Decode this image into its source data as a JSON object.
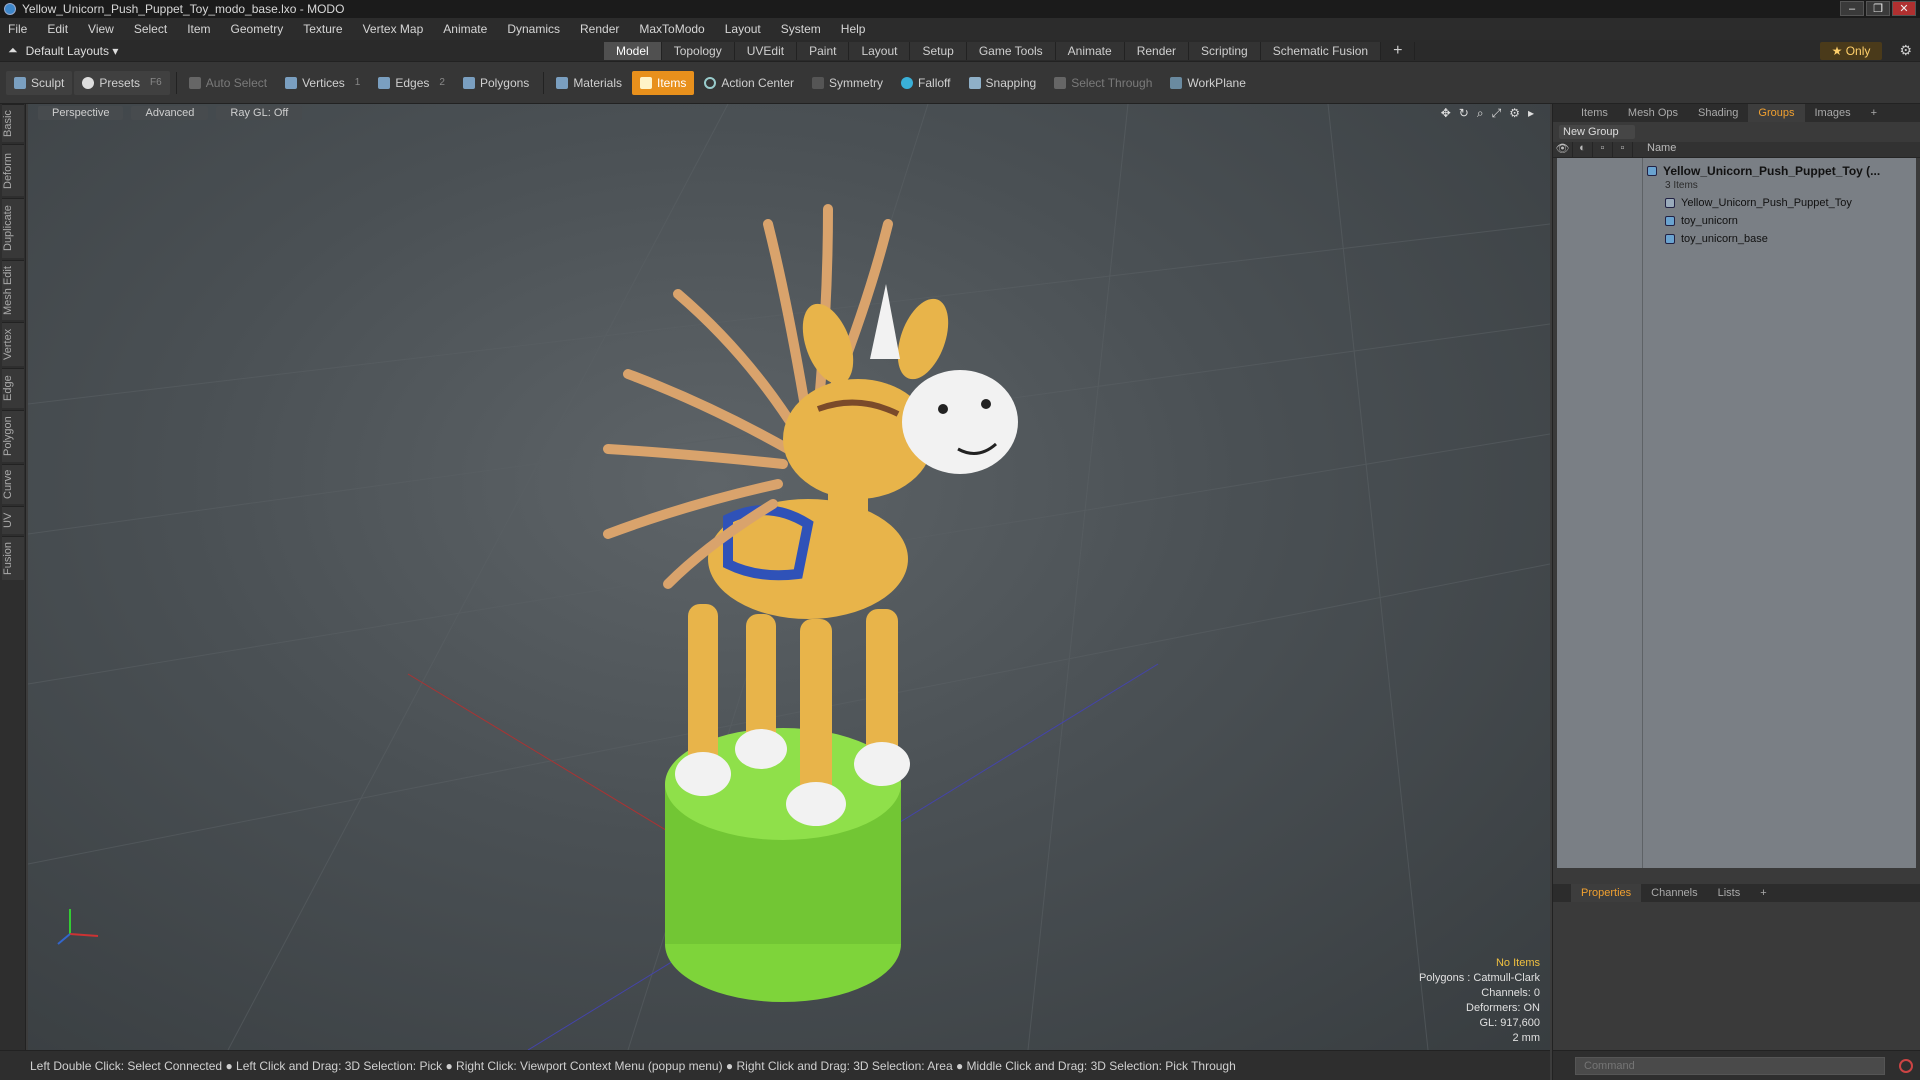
{
  "window": {
    "title": "Yellow_Unicorn_Push_Puppet_Toy_modo_base.lxo - MODO",
    "controls": [
      "–",
      "❐",
      "✕"
    ]
  },
  "menu": [
    "File",
    "Edit",
    "View",
    "Select",
    "Item",
    "Geometry",
    "Texture",
    "Vertex Map",
    "Animate",
    "Dynamics",
    "Render",
    "MaxToModo",
    "Layout",
    "System",
    "Help"
  ],
  "layout": {
    "dropdown": "Default Layouts ▾",
    "tabs": [
      "Model",
      "Topology",
      "UVEdit",
      "Paint",
      "Layout",
      "Setup",
      "Game Tools",
      "Animate",
      "Render",
      "Scripting",
      "Schematic Fusion",
      "+"
    ],
    "active_tab": "Model",
    "only_label": "★  Only"
  },
  "toolbar": {
    "sculpt": "Sculpt",
    "presets": "Presets",
    "presets_key": "F6",
    "auto_select": "Auto Select",
    "vertices": "Vertices",
    "vertices_count": "1",
    "edges": "Edges",
    "edges_count": "2",
    "polygons": "Polygons",
    "materials": "Materials",
    "items": "Items",
    "action_center": "Action Center",
    "symmetry": "Symmetry",
    "falloff": "Falloff",
    "snapping": "Snapping",
    "select_through": "Select Through",
    "workplane": "WorkPlane"
  },
  "left_tabs": [
    "Basic",
    "Deform",
    "Duplicate",
    "Mesh Edit",
    "Vertex",
    "Edge",
    "Polygon",
    "Curve",
    "UV",
    "Fusion"
  ],
  "viewport": {
    "view_mode": "Perspective",
    "shading": "Advanced",
    "raygl": "Ray GL: Off",
    "info": {
      "selection": "No Items",
      "polygons": "Polygons : Catmull-Clark",
      "channels": "Channels: 0",
      "deformers": "Deformers: ON",
      "gl": "GL: 917,600",
      "scale": "2 mm"
    },
    "colors": {
      "body": "#e8b44a",
      "mane": "#d9a36c",
      "base": "#7ed43a",
      "face": "#f2f2f2",
      "saddle": "#2f52b8"
    }
  },
  "status": "Left Double Click: Select Connected ● Left Click and Drag: 3D Selection: Pick ● Right Click: Viewport Context Menu (popup menu) ● Right Click and Drag: 3D Selection: Area ● Middle Click and Drag: 3D Selection: Pick Through",
  "right_panel": {
    "tabs": [
      "Items",
      "Mesh Ops",
      "Shading",
      "Groups",
      "Images",
      "+"
    ],
    "active_tab": "Groups",
    "new_group": "New Group",
    "name_header": "Name",
    "tree": {
      "parent": "Yellow_Unicorn_Push_Puppet_Toy (...",
      "count": "3 Items",
      "children": [
        "Yellow_Unicorn_Push_Puppet_Toy",
        "toy_unicorn",
        "toy_unicorn_base"
      ]
    },
    "bottom_tabs": [
      "Properties",
      "Channels",
      "Lists",
      "+"
    ],
    "bottom_active": "Properties",
    "command_placeholder": "Command"
  }
}
